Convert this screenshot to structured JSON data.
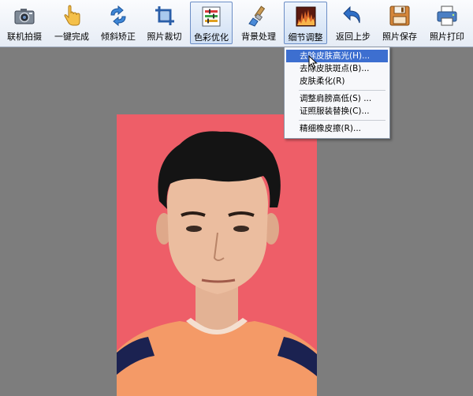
{
  "toolbar": {
    "items": [
      {
        "label": "联机拍摄",
        "icon": "camera-icon"
      },
      {
        "label": "一键完成",
        "icon": "hand-pointer-icon"
      },
      {
        "label": "倾斜矫正",
        "icon": "rotate-arrows-icon"
      },
      {
        "label": "照片裁切",
        "icon": "crop-icon"
      },
      {
        "label": "色彩优化",
        "icon": "color-sliders-icon"
      },
      {
        "label": "背景处理",
        "icon": "brush-icon"
      },
      {
        "label": "细节调整",
        "icon": "detail-chart-icon"
      },
      {
        "label": "返回上步",
        "icon": "undo-arrow-icon"
      },
      {
        "label": "照片保存",
        "icon": "floppy-disk-icon"
      },
      {
        "label": "照片打印",
        "icon": "printer-icon"
      }
    ],
    "selected": "细节调整"
  },
  "menu": {
    "items": [
      {
        "label": "去除皮肤高光(H)...",
        "highlighted": true
      },
      {
        "label": "去除皮肤斑点(B)..."
      },
      {
        "label": "皮肤柔化(R)"
      },
      {
        "label": "调整肩膀高低(S) ..."
      },
      {
        "label": "证照服装替换(C)..."
      },
      {
        "label": "精细橡皮擦(R)..."
      }
    ]
  },
  "colors": {
    "accent": "#3d6fd0",
    "photo_background": "#ee5e68",
    "workspace": "#7d7d7d"
  }
}
